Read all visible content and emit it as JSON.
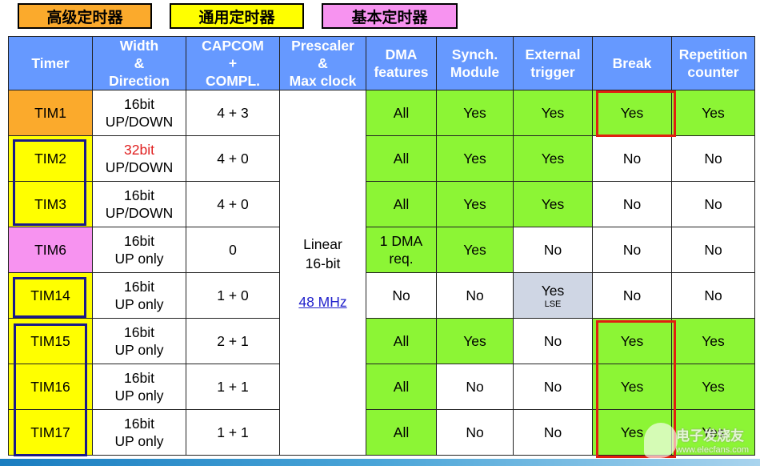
{
  "legend": {
    "advanced": {
      "label": "高级定时器",
      "color": "#fbaa2c"
    },
    "general": {
      "label": "通用定时器",
      "color": "#ffff00"
    },
    "basic": {
      "label": "基本定时器",
      "color": "#f793f0"
    }
  },
  "table": {
    "headers": {
      "timer": [
        "Timer"
      ],
      "width": [
        "Width",
        "&",
        "Direction"
      ],
      "capcom": [
        "CAPCOM",
        "+",
        "COMPL."
      ],
      "prescaler": [
        "Prescaler",
        "&",
        "Max clock"
      ],
      "dma": [
        "DMA",
        "features"
      ],
      "synch": [
        "Synch.",
        "Module"
      ],
      "external": [
        "External",
        "trigger"
      ],
      "break": [
        "Break"
      ],
      "repetition": [
        "Repetition",
        "counter"
      ]
    },
    "prescaler_shared": {
      "line1": "Linear",
      "line2": "16-bit",
      "clock": "48 MHz"
    },
    "rows": [
      {
        "timer": "TIM1",
        "category": "advanced",
        "width_bits": "16bit",
        "direction": "UP/DOWN",
        "capcom": "4 + 3",
        "dma": "All",
        "synch": "Yes",
        "external": "Yes",
        "external_note": "",
        "break": "Yes",
        "repetition": "Yes"
      },
      {
        "timer": "TIM2",
        "category": "general",
        "width_bits": "32bit",
        "direction": "UP/DOWN",
        "capcom": "4 + 0",
        "dma": "All",
        "synch": "Yes",
        "external": "Yes",
        "external_note": "",
        "break": "No",
        "repetition": "No"
      },
      {
        "timer": "TIM3",
        "category": "general",
        "width_bits": "16bit",
        "direction": "UP/DOWN",
        "capcom": "4 + 0",
        "dma": "All",
        "synch": "Yes",
        "external": "Yes",
        "external_note": "",
        "break": "No",
        "repetition": "No"
      },
      {
        "timer": "TIM6",
        "category": "basic",
        "width_bits": "16bit",
        "direction": "UP only",
        "capcom": "0",
        "dma": "1 DMA req.",
        "synch": "Yes",
        "external": "No",
        "external_note": "",
        "break": "No",
        "repetition": "No"
      },
      {
        "timer": "TIM14",
        "category": "general",
        "width_bits": "16bit",
        "direction": "UP only",
        "capcom": "1 + 0",
        "dma": "No",
        "synch": "No",
        "external": "Yes",
        "external_note": "LSE",
        "break": "No",
        "repetition": "No"
      },
      {
        "timer": "TIM15",
        "category": "general",
        "width_bits": "16bit",
        "direction": "UP only",
        "capcom": "2 + 1",
        "dma": "All",
        "synch": "Yes",
        "external": "No",
        "external_note": "",
        "break": "Yes",
        "repetition": "Yes"
      },
      {
        "timer": "TIM16",
        "category": "general",
        "width_bits": "16bit",
        "direction": "UP only",
        "capcom": "1 + 1",
        "dma": "All",
        "synch": "No",
        "external": "No",
        "external_note": "",
        "break": "Yes",
        "repetition": "Yes"
      },
      {
        "timer": "TIM17",
        "category": "general",
        "width_bits": "16bit",
        "direction": "UP only",
        "capcom": "1 + 1",
        "dma": "All",
        "synch": "No",
        "external": "No",
        "external_note": "",
        "break": "Yes",
        "repetition": "Yes"
      }
    ]
  },
  "colors": {
    "header_bg": "#6699ff",
    "feature_yes": "#8cf535",
    "lse_bg": "#cfd6e4",
    "highlight_32bit": "#e02020",
    "group_box": "#1a1a8a",
    "break_box": "#e02010"
  },
  "watermark": {
    "text": "电子发烧友",
    "url": "www.elecfans.com"
  }
}
